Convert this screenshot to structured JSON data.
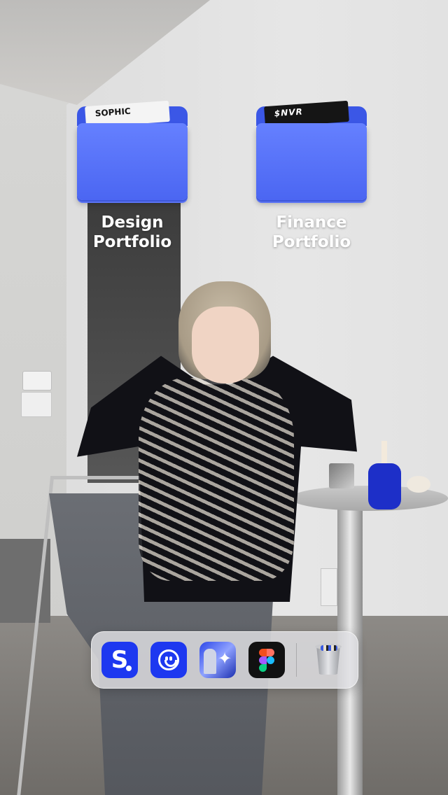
{
  "desktop": {
    "folders": [
      {
        "label_line1": "Design",
        "label_line2": "Portfolio",
        "sticker_text": "SOPHIC",
        "icon": "folder-icon"
      },
      {
        "label_line1": "Finance",
        "label_line2": "Portfolio",
        "sticker_text": "$NVR",
        "icon": "folder-icon"
      }
    ]
  },
  "dock": {
    "apps": [
      {
        "name": "S",
        "icon": "s-app-icon"
      },
      {
        "name": "smiley",
        "icon": "smiley-app-icon"
      },
      {
        "name": "photo",
        "icon": "photo-app-icon"
      },
      {
        "name": "figma",
        "icon": "figma-icon"
      },
      {
        "name": "trash",
        "icon": "trash-icon"
      }
    ],
    "s_app_letter": "S",
    "photo_app_glyph": "✦"
  },
  "colors": {
    "folder_blue": "#5672f7",
    "app_blue": "#1d38f0",
    "dock_bg": "#e1e1e4"
  }
}
